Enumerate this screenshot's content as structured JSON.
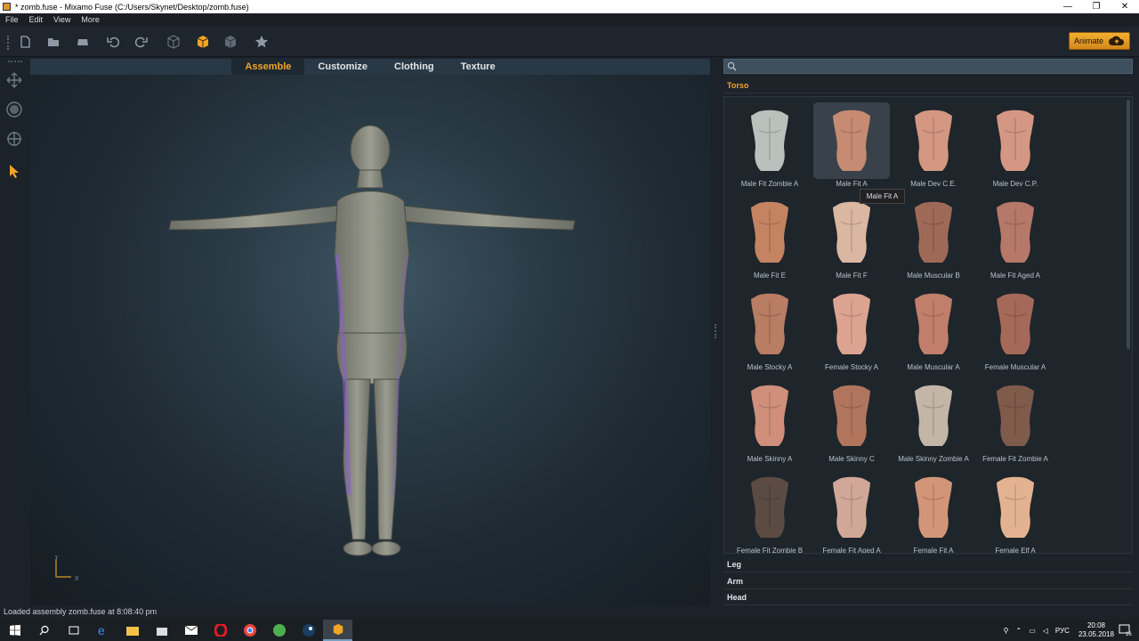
{
  "window": {
    "title": "* zomb.fuse - Mixamo Fuse (C:/Users/Skynet/Desktop/zomb.fuse)"
  },
  "menu": [
    "File",
    "Edit",
    "View",
    "More"
  ],
  "toolbar": {
    "animate_label": "Animate"
  },
  "viewport": {
    "tabs": [
      "Assemble",
      "Customize",
      "Clothing",
      "Texture"
    ],
    "active_tab": "Assemble",
    "axis": {
      "y": "Y",
      "x": "X"
    }
  },
  "status": "Loaded assembly zomb.fuse at 8:08:40 pm",
  "panel": {
    "search_placeholder": "",
    "categories": [
      "Torso",
      "Leg",
      "Arm",
      "Head"
    ],
    "selected_item": "Male Fit A",
    "tooltip": "Male Fit A",
    "items": [
      {
        "label": "Male Fit Zombie A",
        "color": "#b9c1bc"
      },
      {
        "label": "Male Fit A",
        "color": "#c78a73"
      },
      {
        "label": "Male Dev C.E.",
        "color": "#d49781"
      },
      {
        "label": "Male Dev C.P.",
        "color": "#d49784"
      },
      {
        "label": "Male Fit E",
        "color": "#c48361"
      },
      {
        "label": "Male Fit F",
        "color": "#dab7a1"
      },
      {
        "label": "Male Muscular B",
        "color": "#9e6a57"
      },
      {
        "label": "Male Fit Aged A",
        "color": "#b67868"
      },
      {
        "label": "Male Stocky A",
        "color": "#b87d63"
      },
      {
        "label": "Female Stocky A",
        "color": "#dca490"
      },
      {
        "label": "Male Muscular A",
        "color": "#c07e6b"
      },
      {
        "label": "Female Muscular A",
        "color": "#a56959"
      },
      {
        "label": "Male Skinny A",
        "color": "#cf8f7a"
      },
      {
        "label": "Male Skinny C",
        "color": "#b1755e"
      },
      {
        "label": "Male Skinny Zombie A",
        "color": "#c4b6a6"
      },
      {
        "label": "Female Fit Zombie A",
        "color": "#7f5b4c"
      },
      {
        "label": "Female Fit Zombie B",
        "color": "#5b4b43"
      },
      {
        "label": "Female Fit Aged A",
        "color": "#d1a898"
      },
      {
        "label": "Female Fit A",
        "color": "#d29578"
      },
      {
        "label": "Female Elf A",
        "color": "#e3b391"
      }
    ]
  },
  "taskbar": {
    "language": "РУС",
    "time": "20:08",
    "date": "23.05.2018",
    "notifications": "16"
  },
  "colors": {
    "accent": "#f0a52a",
    "panel_bg": "#1b2229"
  }
}
